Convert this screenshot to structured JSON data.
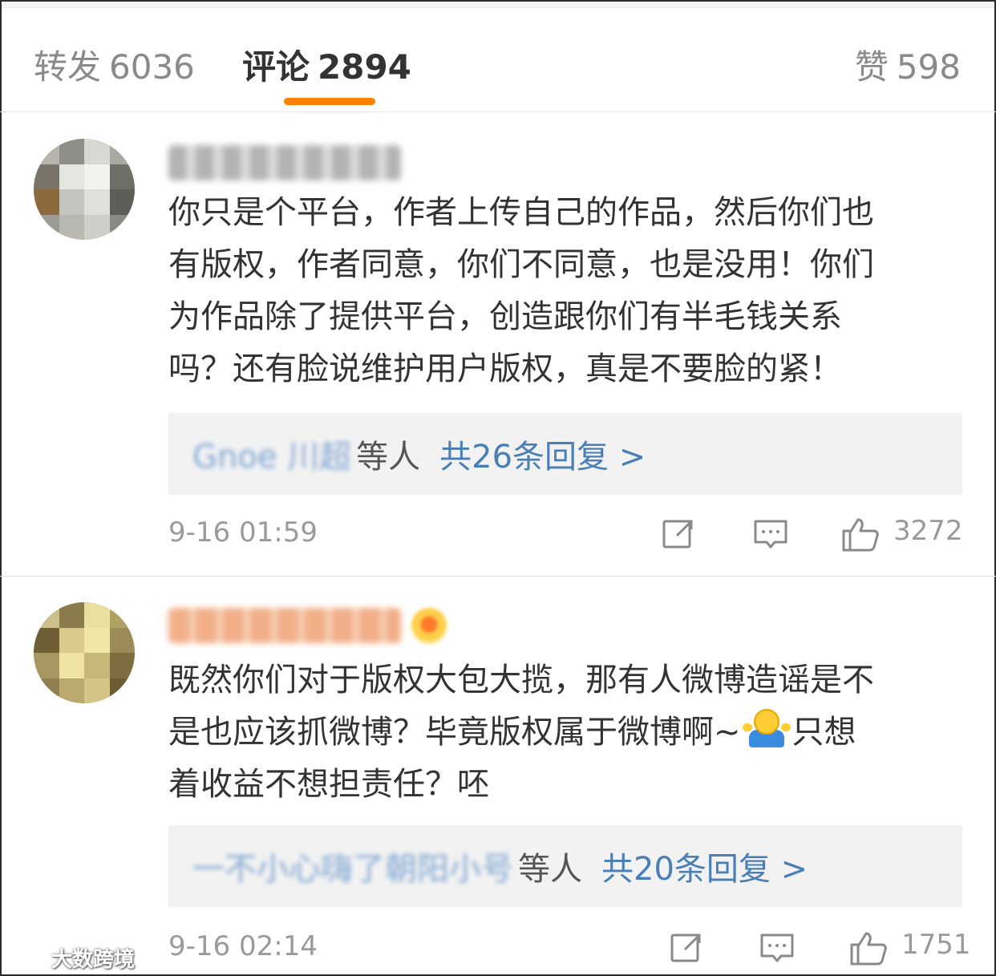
{
  "tabs": {
    "repost": {
      "label": "转发",
      "count": "6036"
    },
    "comment": {
      "label": "评论",
      "count": "2894"
    },
    "like": {
      "label": "赞",
      "count": "598"
    }
  },
  "colors": {
    "accent": "#ff8200",
    "link": "#4a7fb5"
  },
  "comments": [
    {
      "lines": [
        "你只是个平台，作者上传自己的作品，然后你们也",
        "有版权，作者同意，你们不同意，也是没用！你们",
        "为作品除了提供平台，创造跟你们有半毛钱关系",
        "吗？还有脸说维护用户版权，真是不要脸的紧！"
      ],
      "replies_suffix": "等人",
      "replies_count": "共26条回复 >",
      "time": "9-16 01:59",
      "likes": "3272"
    },
    {
      "lines": [
        "既然你们对于版权大包大揽，那有人微博造谣是不",
        "是也应该抓微博？毕竟版权属于微博啊~",
        "只想",
        "着收益不想担责任？呸"
      ],
      "replies_suffix": "等人",
      "replies_count": "共20条回复 >",
      "time": "9-16 02:14",
      "likes": "1751"
    }
  ],
  "watermark": {
    "text": "大数跨境"
  }
}
